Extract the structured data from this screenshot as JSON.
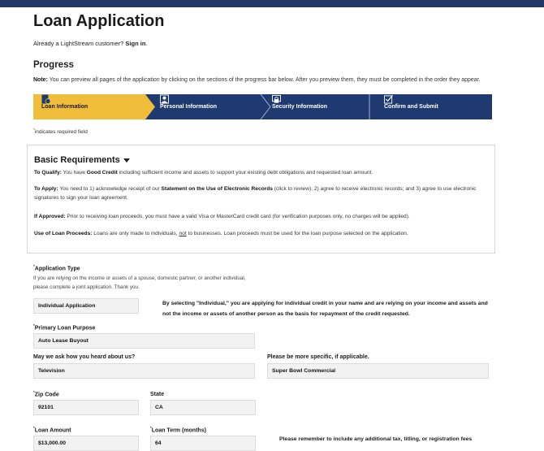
{
  "page": {
    "title": "Loan Application",
    "signin_prefix": "Already a LightStream customer?",
    "signin_link": "Sign in",
    "signin_suffix": "."
  },
  "progress": {
    "heading": "Progress",
    "note_label": "Note:",
    "note_text": " You can preview all pages of the application by clicking on the sections of the progress bar below. After you preview them, they must be completed in the order they appear.",
    "steps": [
      {
        "label": "Loan Information",
        "icon": "document-dollar-icon",
        "active": true
      },
      {
        "label": "Personal Information",
        "icon": "person-icon",
        "active": false
      },
      {
        "label": "Security Information",
        "icon": "lock-screen-icon",
        "active": false
      },
      {
        "label": "Confirm and Submit",
        "icon": "checkbox-icon",
        "active": false
      }
    ],
    "colors": {
      "active": "#f0bd3b",
      "inactive": "#1f3a70",
      "separator": "#ffffff"
    }
  },
  "required_note": "indicates required field",
  "required_marker": "*",
  "basic": {
    "heading": "Basic Requirements",
    "qualify_label": "To Qualify:",
    "qualify_pre": " You have ",
    "qualify_bold": "Good Credit",
    "qualify_post": " including sufficient income and assets to support your existing debt obligations and requested loan amount.",
    "apply_label": "To Apply:",
    "apply_pre": " You need to 1) acknowledge receipt of our ",
    "apply_bold": "Statement on the Use of Electronic Records",
    "apply_post": " (click to review); 2) agree to receive electronic records; and 3) agree to use electronic signatures to sign your loan agreement.",
    "approved_label": "If Approved:",
    "approved_text": " Prior to receiving loan proceeds, you must have a valid Visa or MasterCard credit card (for verification purposes only, no charges will be applied).",
    "proceeds_label": "Use of Loan Proceeds:",
    "proceeds_pre": " Loans are only made to individuals, ",
    "proceeds_underline": "not",
    "proceeds_post": " to businesses. Loan proceeds must be used for the loan purpose selected on the application."
  },
  "form": {
    "app_type_label": "Application Type",
    "app_type_help": "If you are relying on the income or assets of a spouse, domestic partner, or another individual, please complete a joint application. Thank you.",
    "app_type_value": "Individual Application",
    "app_type_desc": "By selecting \"Individual,\" you are applying for individual credit in your name and are relying on your income and assets and not the income or assets of another person as the basis for repayment of the credit requested.",
    "purpose_label": "Primary Loan Purpose",
    "purpose_value": "Auto Lease Buyout",
    "heard_label": "May we ask how you heard about us?",
    "heard_value": "Television",
    "specific_label": "Please be more specific, if applicable.",
    "specific_value": "Super Bowl Commercial",
    "zip_label": "Zip Code",
    "zip_value": "92101",
    "state_label": "State",
    "state_value": "CA",
    "amount_label": "Loan Amount",
    "amount_value": "$13,000.00",
    "term_label": "Loan Term (months)",
    "term_value": "64",
    "reminder": "Please remember to include any additional tax, titling, or registration fees"
  }
}
